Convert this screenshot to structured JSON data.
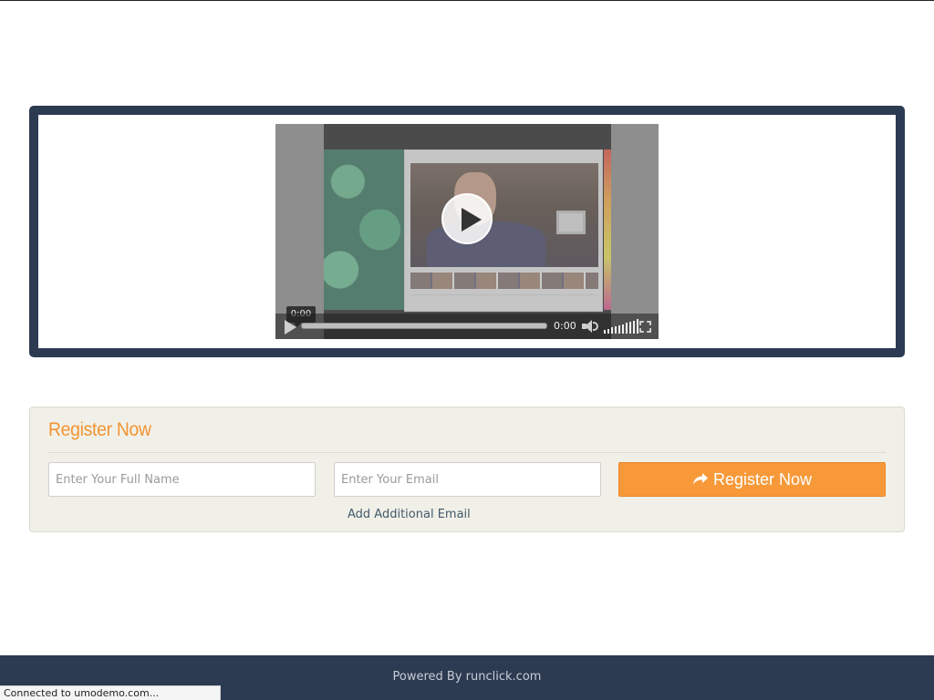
{
  "video": {
    "tooltip_time": "0:00",
    "current_time": "0:00",
    "progress": 0,
    "volume_level": 1.0,
    "icons": {
      "play_overlay": "play-circle-icon",
      "play": "play-icon",
      "mute": "speaker-icon",
      "fullscreen": "fullscreen-icon"
    }
  },
  "register": {
    "title": "Register Now",
    "name_placeholder": "Enter Your Full Name",
    "email_placeholder": "Enter Your Email",
    "button_label": "Register Now",
    "button_icon": "share-arrow-icon",
    "add_email_link": "Add Additional Email"
  },
  "footer": {
    "text": "Powered By runclick.com"
  },
  "status_bar": {
    "text": "Connected to umodemo.com..."
  },
  "colors": {
    "panel_dark": "#2c3a52",
    "accent_orange": "#f89939",
    "register_bg": "#f1f0e8"
  }
}
